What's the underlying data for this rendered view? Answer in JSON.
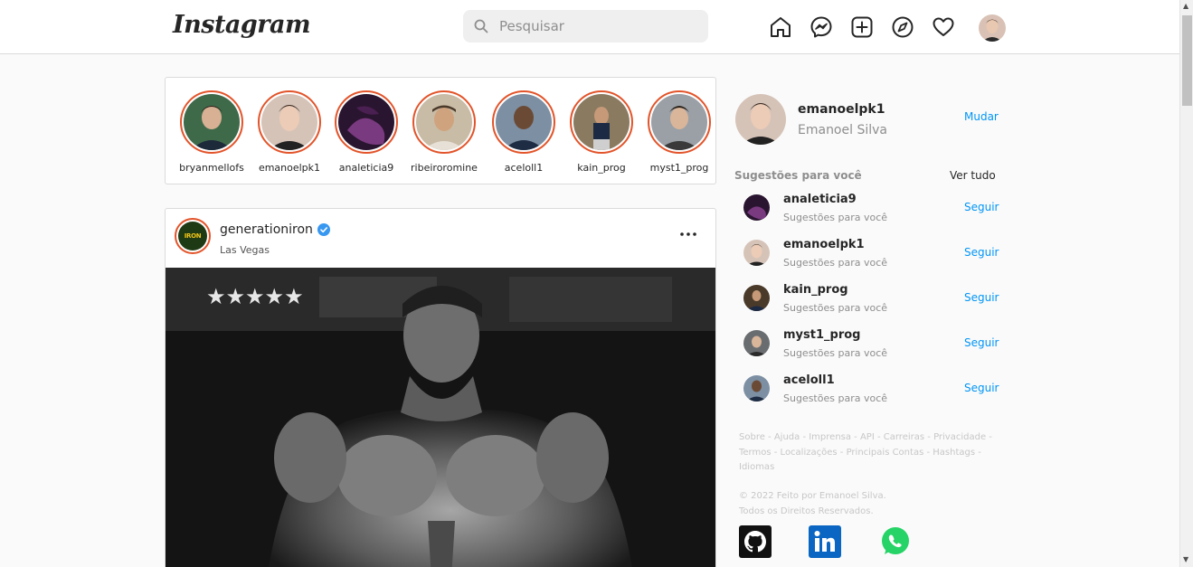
{
  "header": {
    "logo": "Instagram",
    "search_placeholder": "Pesquisar"
  },
  "stories": [
    {
      "username": "bryanmellofs",
      "color": "#2c4a3a"
    },
    {
      "username": "emanoelpk1",
      "color": "#c9a89a"
    },
    {
      "username": "analeticia9",
      "color": "#5a2a5e"
    },
    {
      "username": "ribeiroromine",
      "color": "#b8a48c"
    },
    {
      "username": "aceloll1",
      "color": "#3b4d6b"
    },
    {
      "username": "kain_prog",
      "color": "#6b5d4a"
    },
    {
      "username": "myst1_prog",
      "color": "#7a7d80"
    }
  ],
  "post": {
    "username": "generationiron",
    "location": "Las Vegas",
    "avatar_text": "IRON"
  },
  "profile": {
    "username": "emanoelpk1",
    "name": "Emanoel Silva",
    "switch_label": "Mudar"
  },
  "suggestions": {
    "title": "Sugestões para você",
    "see_all": "Ver tudo",
    "items": [
      {
        "username": "analeticia9",
        "subtitle": "Sugestões para você",
        "follow": "Seguir",
        "color": "#5a2a5e"
      },
      {
        "username": "emanoelpk1",
        "subtitle": "Sugestões para você",
        "follow": "Seguir",
        "color": "#c9a89a"
      },
      {
        "username": "kain_prog",
        "subtitle": "Sugestões para você",
        "follow": "Seguir",
        "color": "#4a3a2a"
      },
      {
        "username": "myst1_prog",
        "subtitle": "Sugestões para você",
        "follow": "Seguir",
        "color": "#6a6d70"
      },
      {
        "username": "aceloll1",
        "subtitle": "Sugestões para você",
        "follow": "Seguir",
        "color": "#3b4d6b"
      }
    ]
  },
  "footer": {
    "links": [
      "Sobre",
      "Ajuda",
      "Imprensa",
      "API",
      "Carreiras",
      "Privacidade",
      "Termos",
      "Localizações",
      "Principais Contas",
      "Hashtags",
      "Idiomas"
    ],
    "copyright_line1": "© 2022 Feito por Emanoel Silva.",
    "copyright_line2": "Todos os Direitos Reservados."
  },
  "social_icons": [
    "github-icon",
    "linkedin-icon",
    "whatsapp-icon"
  ],
  "colors": {
    "story_ring": "#e2542a",
    "link_blue": "#0095f6",
    "verified_blue": "#3897f0"
  }
}
